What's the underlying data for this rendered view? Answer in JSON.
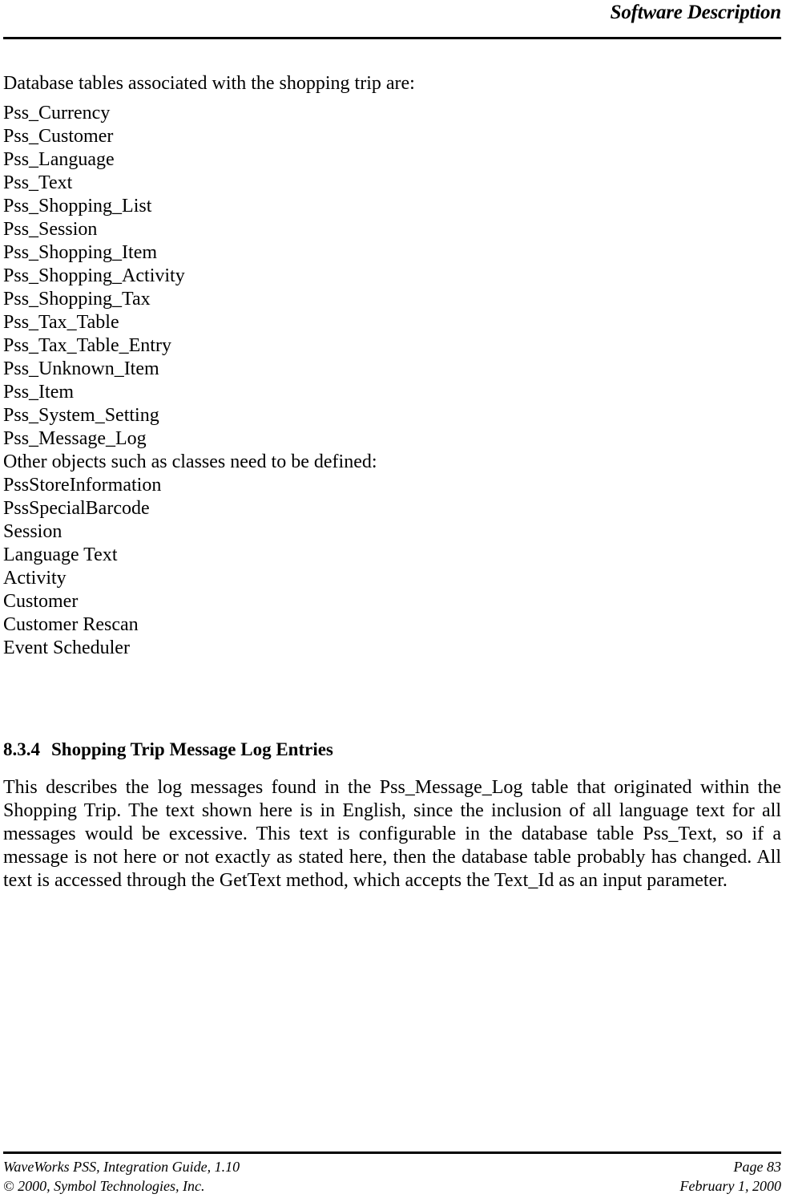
{
  "header": {
    "title": "Software Description"
  },
  "body": {
    "intro_line": "Database tables associated with the shopping trip are:",
    "list_items": [
      "Pss_Currency",
      "Pss_Customer",
      "Pss_Language",
      "Pss_Text",
      "Pss_Shopping_List",
      "Pss_Session",
      "Pss_Shopping_Item",
      "Pss_Shopping_Activity",
      "Pss_Shopping_Tax",
      "Pss_Tax_Table",
      "Pss_Tax_Table_Entry",
      "Pss_Unknown_Item",
      "Pss_Item",
      "Pss_System_Setting",
      "Pss_Message_Log",
      "Other objects such as classes need to be defined:",
      "PssStoreInformation",
      "PssSpecialBarcode",
      "Session",
      "Language Text",
      "Activity",
      "Customer",
      "Customer Rescan",
      "Event Scheduler"
    ],
    "section": {
      "number": "8.3.4",
      "title": "Shopping Trip Message Log Entries"
    },
    "paragraph": "This describes the log messages found in the Pss_Message_Log table that originated within the Shopping Trip.  The text shown here is in English, since the inclusion of all language text for all messages would be excessive.  This text is configurable in the database table Pss_Text, so if a message is not here or not exactly as stated here, then the database table probably has changed.  All text is accessed through the GetText method, which accepts the Text_Id as an input parameter."
  },
  "footer": {
    "guide": "WaveWorks PSS, Integration Guide, 1.10",
    "copyright": "© 2000, Symbol Technologies, Inc.",
    "page": "Page 83",
    "date": "February 1, 2000"
  }
}
